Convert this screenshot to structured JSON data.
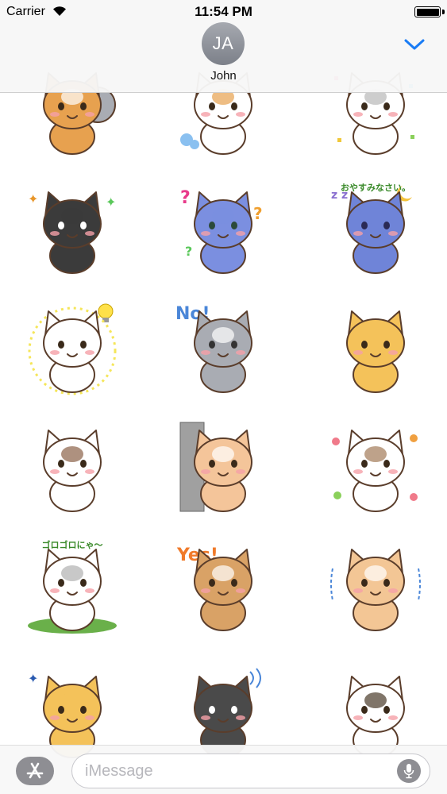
{
  "status_bar": {
    "carrier": "Carrier",
    "time": "11:54 PM",
    "battery_level": 1.0,
    "wifi_icon": "wifi-icon"
  },
  "header": {
    "avatar_initials": "JA",
    "contact_name": "John",
    "collapse_icon": "chevron-down-icon",
    "accent": "#1a7cf5"
  },
  "stickers": [
    {
      "name": "sticker-calico-cats-pair",
      "caption": ""
    },
    {
      "name": "sticker-cat-huff",
      "caption": ""
    },
    {
      "name": "sticker-cat-confetti",
      "caption": ""
    },
    {
      "name": "sticker-black-cat-tongue",
      "caption": ""
    },
    {
      "name": "sticker-blue-cat-question",
      "caption": ""
    },
    {
      "name": "sticker-blue-cat-sleeping",
      "caption": "おやすみなさい。"
    },
    {
      "name": "sticker-white-cat-idea",
      "caption": ""
    },
    {
      "name": "sticker-gray-cat-no",
      "caption": "No!"
    },
    {
      "name": "sticker-orange-cat-crying",
      "caption": ""
    },
    {
      "name": "sticker-himalayan-cat-crying",
      "caption": ""
    },
    {
      "name": "sticker-cat-peeking-wall",
      "caption": ""
    },
    {
      "name": "sticker-himalayan-cat-flowers",
      "caption": ""
    },
    {
      "name": "sticker-white-cat-rolling",
      "caption": "ゴロゴロにゃ〜"
    },
    {
      "name": "sticker-tabby-cat-yes",
      "caption": "Yes!"
    },
    {
      "name": "sticker-cat-shivering",
      "caption": ""
    },
    {
      "name": "sticker-orange-cat-partial",
      "caption": ""
    },
    {
      "name": "sticker-black-cat-partial",
      "caption": ""
    },
    {
      "name": "sticker-calico-cat-partial",
      "caption": ""
    }
  ],
  "bottom_bar": {
    "app_store_icon": "app-store-icon",
    "message_placeholder": "iMessage",
    "message_value": "",
    "mic_icon": "microphone-icon"
  }
}
